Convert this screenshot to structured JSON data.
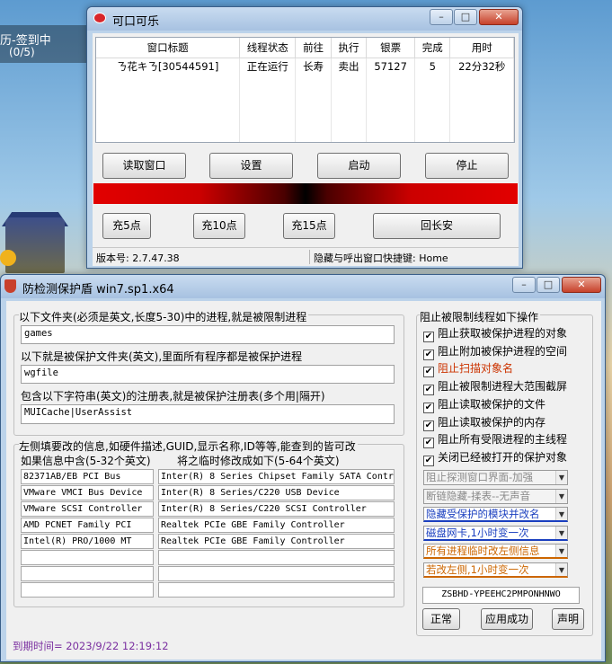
{
  "background_game": {
    "task_title": "历-签到中",
    "task_count": "(0/5)"
  },
  "main_window": {
    "title": "可口可乐",
    "controls": {
      "min": "–",
      "max": "□",
      "close": "✕"
    },
    "list": {
      "columns": [
        "窗口标题",
        "线程状态",
        "前往",
        "执行",
        "银票",
        "完成",
        "用时"
      ],
      "rows": [
        [
          "ㄋ花キㄋ[30544591]",
          "正在运行",
          "长寿",
          "卖出",
          "57127",
          "5",
          "22分32秒"
        ]
      ]
    },
    "buttons": {
      "read": "读取窗口",
      "settings": "设置",
      "start": "启动",
      "stop": "停止"
    },
    "charge_buttons": {
      "c5": "充5点",
      "c10": "充10点",
      "c15": "充15点",
      "home": "回长安"
    },
    "status": {
      "version": "版本号: 2.7.47.38",
      "hotkey": "隐藏与呼出窗口快捷键: Home"
    }
  },
  "protect_window": {
    "title": "防检测保护盾 win7.sp1.x64",
    "controls": {
      "min": "–",
      "max": "□",
      "close": "✕"
    },
    "left": {
      "folder_label": "以下文件夹(必须是英文,长度5-30)中的进程,就是被限制进程",
      "folder_value": "games",
      "protect_label": "以下就是被保护文件夹(英文),里面所有程序都是被保护进程",
      "protect_value": "wgfile",
      "registry_label": "包含以下字符串(英文)的注册表,就是被保护注册表(多个用|隔开)",
      "registry_value": "MUICache|UserAssist",
      "hw_group_label": "左侧填要改的信息,如硬件描述,GUID,显示名称,ID等等,能查到的皆可改",
      "col1_label": "如果信息中含(5-32个英文)",
      "col2_label": "将之临时修改成如下(5-64个英文)",
      "col1_values": [
        "82371AB/EB PCI Bus",
        "VMware VMCI Bus Device",
        "VMware SCSI Controller",
        "AMD PCNET Family PCI",
        "Intel(R) PRO/1000 MT",
        "",
        "",
        ""
      ],
      "col2_values": [
        "Inter(R) 8 Series Chipset Family SATA Contr",
        "Inter(R) 8 Series/C220 USB Device",
        "Inter(R) 8 Series/C220 SCSI Controller",
        "Realtek PCIe GBE Family Controller",
        "Realtek PCIe GBE Family Controller",
        "",
        "",
        ""
      ],
      "expire": "到期时间= 2023/9/22 12:19:12"
    },
    "right": {
      "group_label": "阻止被限制线程如下操作",
      "checks": [
        {
          "label": "阻止获取被保护进程的对象",
          "checked": true,
          "color": "#000000"
        },
        {
          "label": "阻止附加被保护进程的空间",
          "checked": true,
          "color": "#000000"
        },
        {
          "label": "阻止扫描对象名",
          "checked": true,
          "color": "#cc3300"
        },
        {
          "label": "阻止被限制进程大范围截屏",
          "checked": true,
          "color": "#000000"
        },
        {
          "label": "阻止读取被保护的文件",
          "checked": true,
          "color": "#000000"
        },
        {
          "label": "阻止读取被保护的内存",
          "checked": true,
          "color": "#000000"
        },
        {
          "label": "阻止所有受限进程的主线程",
          "checked": true,
          "color": "#000000"
        },
        {
          "label": "关闭已经被打开的保护对象",
          "checked": true,
          "color": "#000000"
        }
      ],
      "combos": [
        {
          "label": "阻止探测窗口界面-加强",
          "disabled": true,
          "color": "#8a8a8a",
          "underline": ""
        },
        {
          "label": "断链隐藏-揉表--无声音",
          "disabled": true,
          "color": "#8a8a8a",
          "underline": ""
        },
        {
          "label": "隐藏受保护的模块并改名",
          "disabled": false,
          "color": "#1a3fbf",
          "underline": "#1a3fbf"
        },
        {
          "label": "磁盘网卡,1小时变一次",
          "disabled": false,
          "color": "#1a3fbf",
          "underline": "#1a3fbf"
        },
        {
          "label": "所有进程临时改左侧信息",
          "disabled": false,
          "color": "#cc6600",
          "underline": "#cc6600"
        },
        {
          "label": "若改左侧,1小时变一次",
          "disabled": false,
          "color": "#cc6600",
          "underline": "#cc6600"
        }
      ],
      "code": "ZSBHD-YPEEHC2PMPONHNWO",
      "buttons": {
        "normal": "正常",
        "apply": "应用成功",
        "declare": "声明"
      }
    }
  }
}
